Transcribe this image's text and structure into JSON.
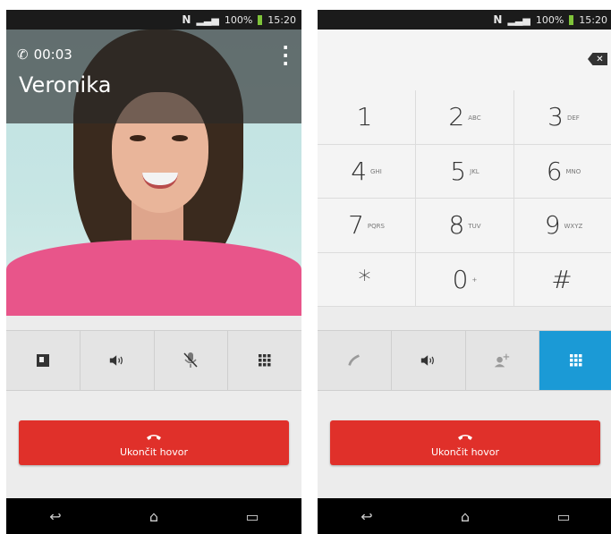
{
  "status": {
    "percent": "100%",
    "time": "15:20"
  },
  "left": {
    "call_timer": "00:03",
    "caller_name": "Veronika",
    "buttons": [
      {
        "icon": "contact-icon"
      },
      {
        "icon": "speaker-icon"
      },
      {
        "icon": "mute-mic-icon"
      },
      {
        "icon": "dialpad-icon"
      }
    ],
    "end_call_label": "Ukončit hovor"
  },
  "right": {
    "keys": [
      {
        "digit": "1",
        "letters": ""
      },
      {
        "digit": "2",
        "letters": "ABC"
      },
      {
        "digit": "3",
        "letters": "DEF"
      },
      {
        "digit": "4",
        "letters": "GHI"
      },
      {
        "digit": "5",
        "letters": "JKL"
      },
      {
        "digit": "6",
        "letters": "MNO"
      },
      {
        "digit": "7",
        "letters": "PQRS"
      },
      {
        "digit": "8",
        "letters": "TUV"
      },
      {
        "digit": "9",
        "letters": "WXYZ"
      },
      {
        "digit": "*",
        "letters": ""
      },
      {
        "digit": "0",
        "letters": "+"
      },
      {
        "digit": "#",
        "letters": ""
      }
    ],
    "buttons": [
      {
        "icon": "handset-icon"
      },
      {
        "icon": "speaker-icon"
      },
      {
        "icon": "add-call-icon"
      },
      {
        "icon": "dialpad-icon"
      }
    ],
    "end_call_label": "Ukončit hovor"
  },
  "colors": {
    "accent": "#1b9ad6",
    "end_call": "#e0302a"
  }
}
